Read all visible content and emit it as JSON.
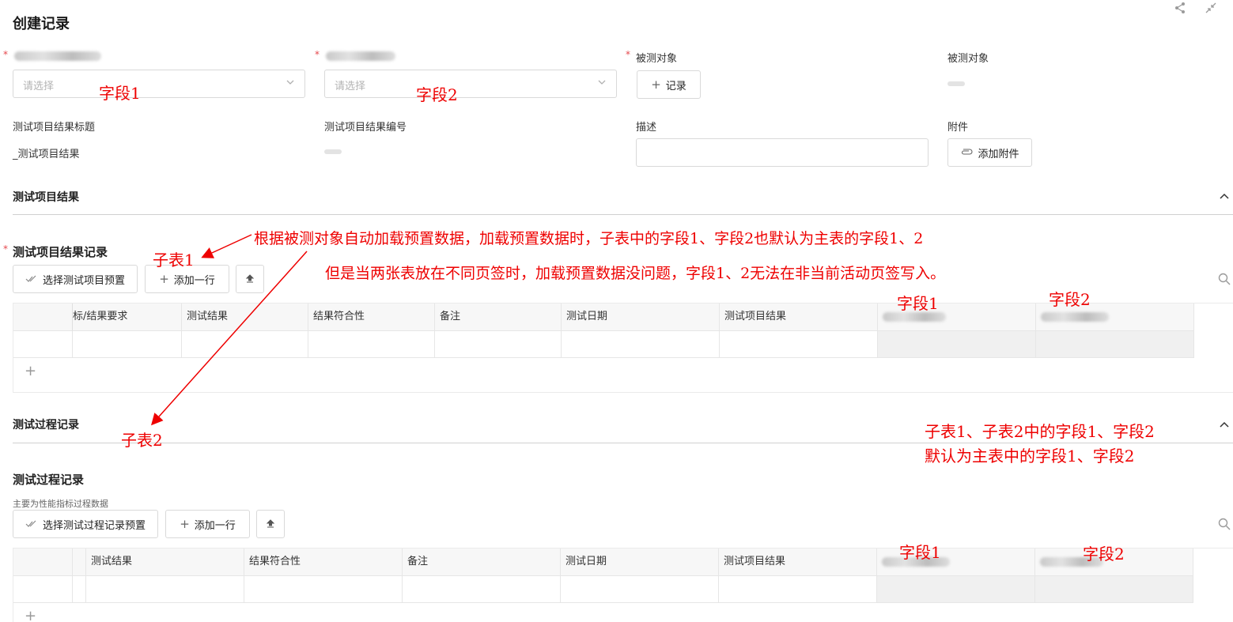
{
  "header": {
    "title": "创建记录"
  },
  "form": {
    "select_placeholder": "请选择",
    "field_target_label": "被测对象",
    "record_button": "记录",
    "field_target2_label": "被测对象",
    "title_label": "测试项目结果标题",
    "title_value": "_测试项目结果",
    "number_label": "测试项目结果编号",
    "desc_label": "描述",
    "attach_label": "附件",
    "attach_button": "添加附件"
  },
  "section1": {
    "title": "测试项目结果",
    "sub_title": "测试项目结果记录",
    "select_preset_button": "选择测试项目预置",
    "add_row_button": "添加一行",
    "columns": [
      "标/结果要求",
      "测试结果",
      "结果符合性",
      "备注",
      "测试日期",
      "测试项目结果"
    ]
  },
  "section2": {
    "title": "测试过程记录",
    "sub_title": "测试过程记录",
    "description": "主要为性能指标过程数据",
    "select_preset_button": "选择测试过程记录预置",
    "add_row_button": "添加一行",
    "columns": [
      "测试结果",
      "结果符合性",
      "备注",
      "测试日期",
      "测试项目结果"
    ]
  },
  "annotations": {
    "field1_a": "字段1",
    "field2_a": "字段2",
    "subtable1": "子表1",
    "subtable2": "子表2",
    "note_line1": "根据被测对象自动加载预置数据，加载预置数据时，子表中的字段1、字段2也默认为主表的字段1、2",
    "note_line2": "但是当两张表放在不同页签时，加载预置数据没问题，字段1、2无法在非当前活动页签写入。",
    "t1_field1": "字段1",
    "t1_field2": "字段2",
    "right_note1": "子表1、子表2中的字段1、字段2",
    "right_note2": "默认为主表中的字段1、字段2",
    "t2_field1": "字段1",
    "t2_field2": "字段2"
  },
  "colors": {
    "accent_red": "#ee0000",
    "required_star": "#e5484d"
  },
  "icons": [
    "share-icon",
    "collapse-icon",
    "chevron-down-icon",
    "plus-icon",
    "paperclip-icon",
    "chevron-up-icon",
    "double-check-icon",
    "upload-icon",
    "search-icon"
  ]
}
